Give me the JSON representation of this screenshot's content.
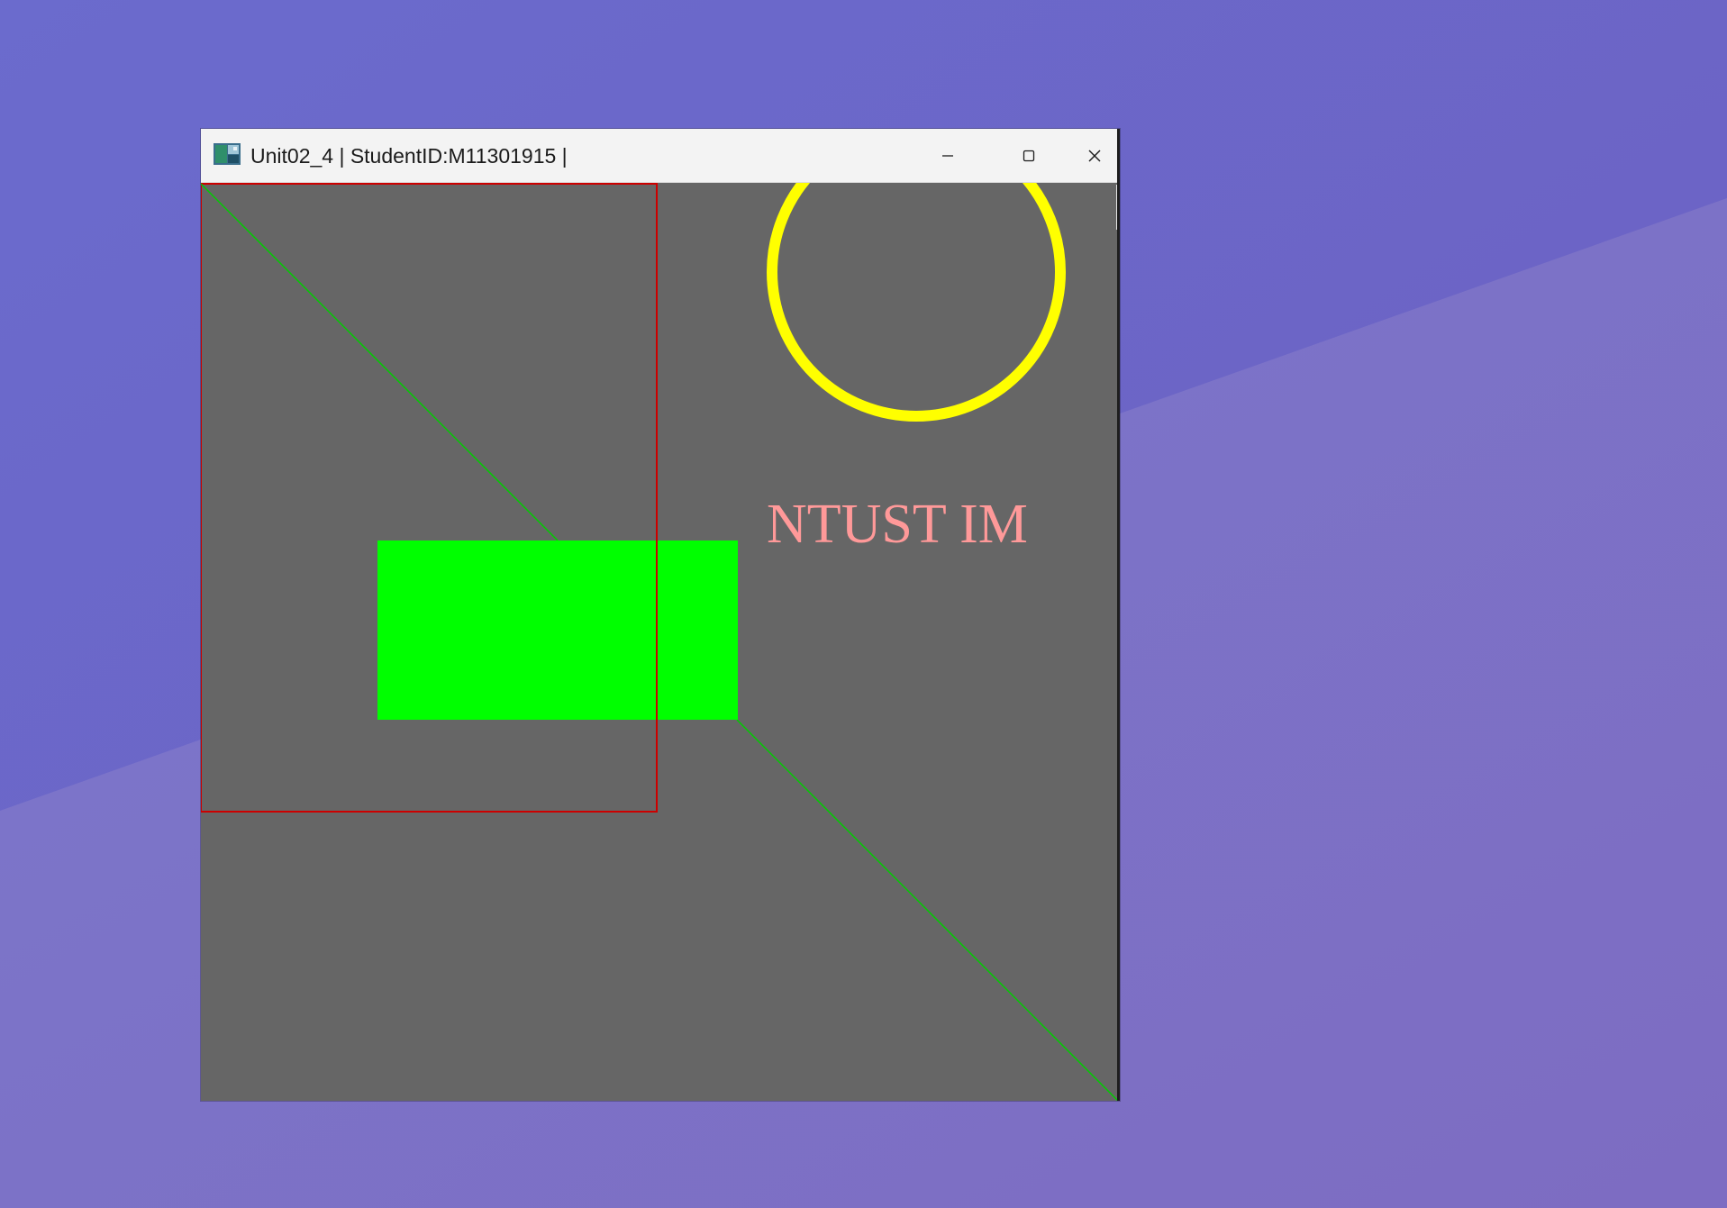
{
  "window": {
    "title": "Unit02_4 | StudentID:M11301915 |",
    "controls": {
      "minimize": "minimize-icon",
      "maximize": "maximize-icon",
      "close": "close-icon"
    }
  },
  "canvas": {
    "background_color": "#666666",
    "text": "NTUST IM",
    "text_color": "#ff9999",
    "circle_color": "#ffff00",
    "rectangle_fill": "#00ff00",
    "rectangle_outline_color": "#cc0000",
    "line_color": "#00cc00"
  },
  "desktop": {
    "colors": [
      "#6c6acb",
      "#7b74c8"
    ]
  }
}
